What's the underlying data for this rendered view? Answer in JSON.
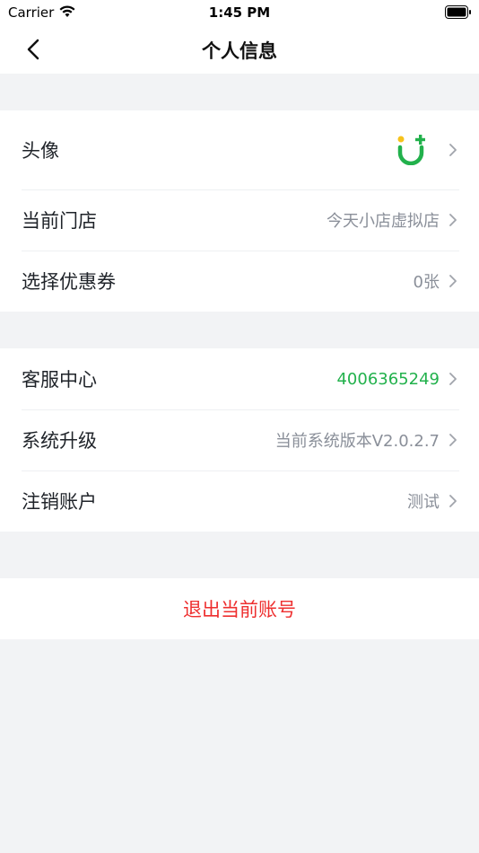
{
  "status_bar": {
    "carrier": "Carrier",
    "time": "1:45 PM"
  },
  "nav": {
    "title": "个人信息"
  },
  "group1": [
    {
      "label": "头像",
      "value": ""
    },
    {
      "label": "当前门店",
      "value": "今天小店虚拟店"
    },
    {
      "label": "选择优惠券",
      "value": "0张"
    }
  ],
  "group2": [
    {
      "label": "客服中心",
      "value": "4006365249"
    },
    {
      "label": "系统升级",
      "value": "当前系统版本V2.0.2.7"
    },
    {
      "label": "注销账户",
      "value": "测试"
    }
  ],
  "logout_label": "退出当前账号",
  "colors": {
    "accent_green": "#22b14c",
    "danger_red": "#ee2f2f",
    "background": "#f2f3f5"
  },
  "icons": [
    "back-arrow-icon",
    "chevron-right-icon",
    "wifi-icon",
    "battery-icon",
    "avatar-logo-icon"
  ]
}
